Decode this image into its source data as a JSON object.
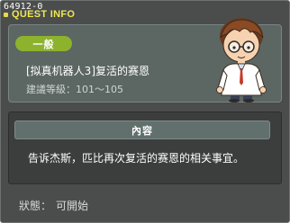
{
  "window": {
    "quest_id": "64912-0",
    "title": "QUEST INFO"
  },
  "quest": {
    "badge": "一般",
    "name": "[拟真机器人3]复活的赛恩",
    "level_text": "建議等級：101～105",
    "npc_icon": "doctor-npc-portrait"
  },
  "content": {
    "header": "內容",
    "text": "告诉杰斯，匹比再次复活的赛恩的相关事宜。"
  },
  "status": {
    "label": "狀態：",
    "value": "可開始"
  },
  "colors": {
    "title_yellow": "#f1e64f",
    "badge_green": "#8db22e",
    "window_bg": "#4a4d4c",
    "panel_bg": "#5c6663"
  }
}
